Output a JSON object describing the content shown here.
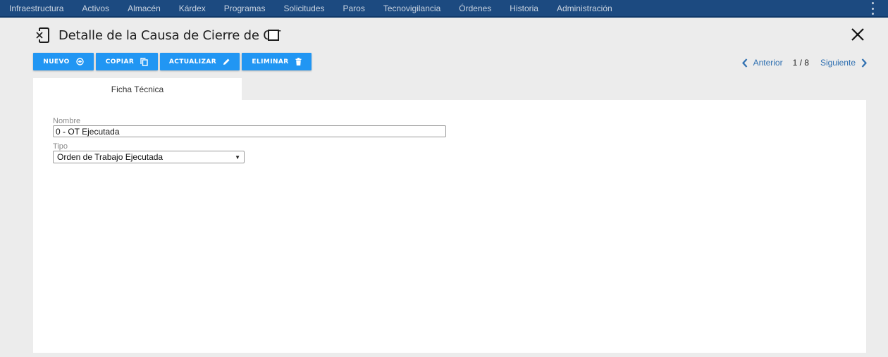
{
  "nav": {
    "items": [
      "Infraestructura",
      "Activos",
      "Almacén",
      "Kárdex",
      "Programas",
      "Solicitudes",
      "Paros",
      "Tecnovigilancia",
      "Órdenes",
      "Historia",
      "Administración"
    ],
    "menu_icon": "kebab-vertical-icon"
  },
  "header": {
    "title": "Detalle de la Causa de Cierre de OT",
    "doc_icon": "document-close-icon",
    "close_icon": "close-icon"
  },
  "toolbar": {
    "nuevo_label": "NUEVO",
    "copiar_label": "COPIAR",
    "actualizar_label": "ACTUALIZAR",
    "eliminar_label": "ELIMINAR",
    "button_color": "#2196f3"
  },
  "pager": {
    "prev_label": "Anterior",
    "next_label": "Siguiente",
    "position": "1 / 8"
  },
  "tabs": [
    {
      "label": "Ficha Técnica",
      "active": true
    }
  ],
  "form": {
    "nombre_label": "Nombre",
    "nombre_value": "0 - OT Ejecutada",
    "tipo_label": "Tipo",
    "tipo_value": "Orden de Trabajo Ejecutada"
  },
  "colors": {
    "nav_bg": "#1c4a80",
    "link": "#2e6fb0",
    "page_bg": "#ececec"
  }
}
